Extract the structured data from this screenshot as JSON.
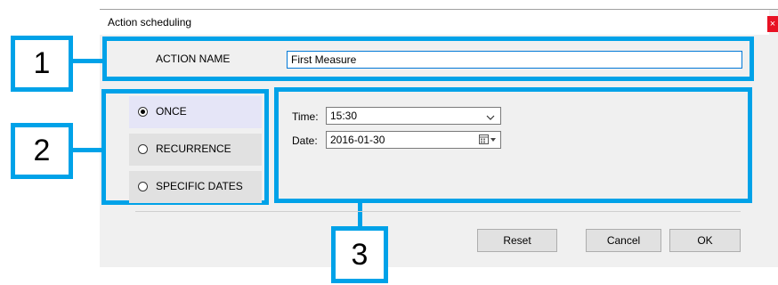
{
  "window": {
    "title": "Action scheduling",
    "close_glyph": "×"
  },
  "callouts": {
    "one": "1",
    "two": "2",
    "three": "3"
  },
  "action": {
    "label": "ACTION NAME",
    "value": "First Measure"
  },
  "schedule_modes": {
    "items": [
      {
        "label": "ONCE",
        "selected": true
      },
      {
        "label": "RECURRENCE",
        "selected": false
      },
      {
        "label": "SPECIFIC DATES",
        "selected": false
      }
    ]
  },
  "timing": {
    "time_label": "Time:",
    "time_value": "15:30",
    "date_label": "Date:",
    "date_value": "2016-01-30"
  },
  "buttons": {
    "reset": "Reset",
    "cancel": "Cancel",
    "ok": "OK"
  },
  "colors": {
    "callout": "#00a2e8",
    "dialog_bg": "#f0f0f0",
    "selected_bg": "#e5e5f7"
  },
  "icons": {
    "time_dropdown": "chevron-down-icon",
    "date_picker": "calendar-icon"
  }
}
